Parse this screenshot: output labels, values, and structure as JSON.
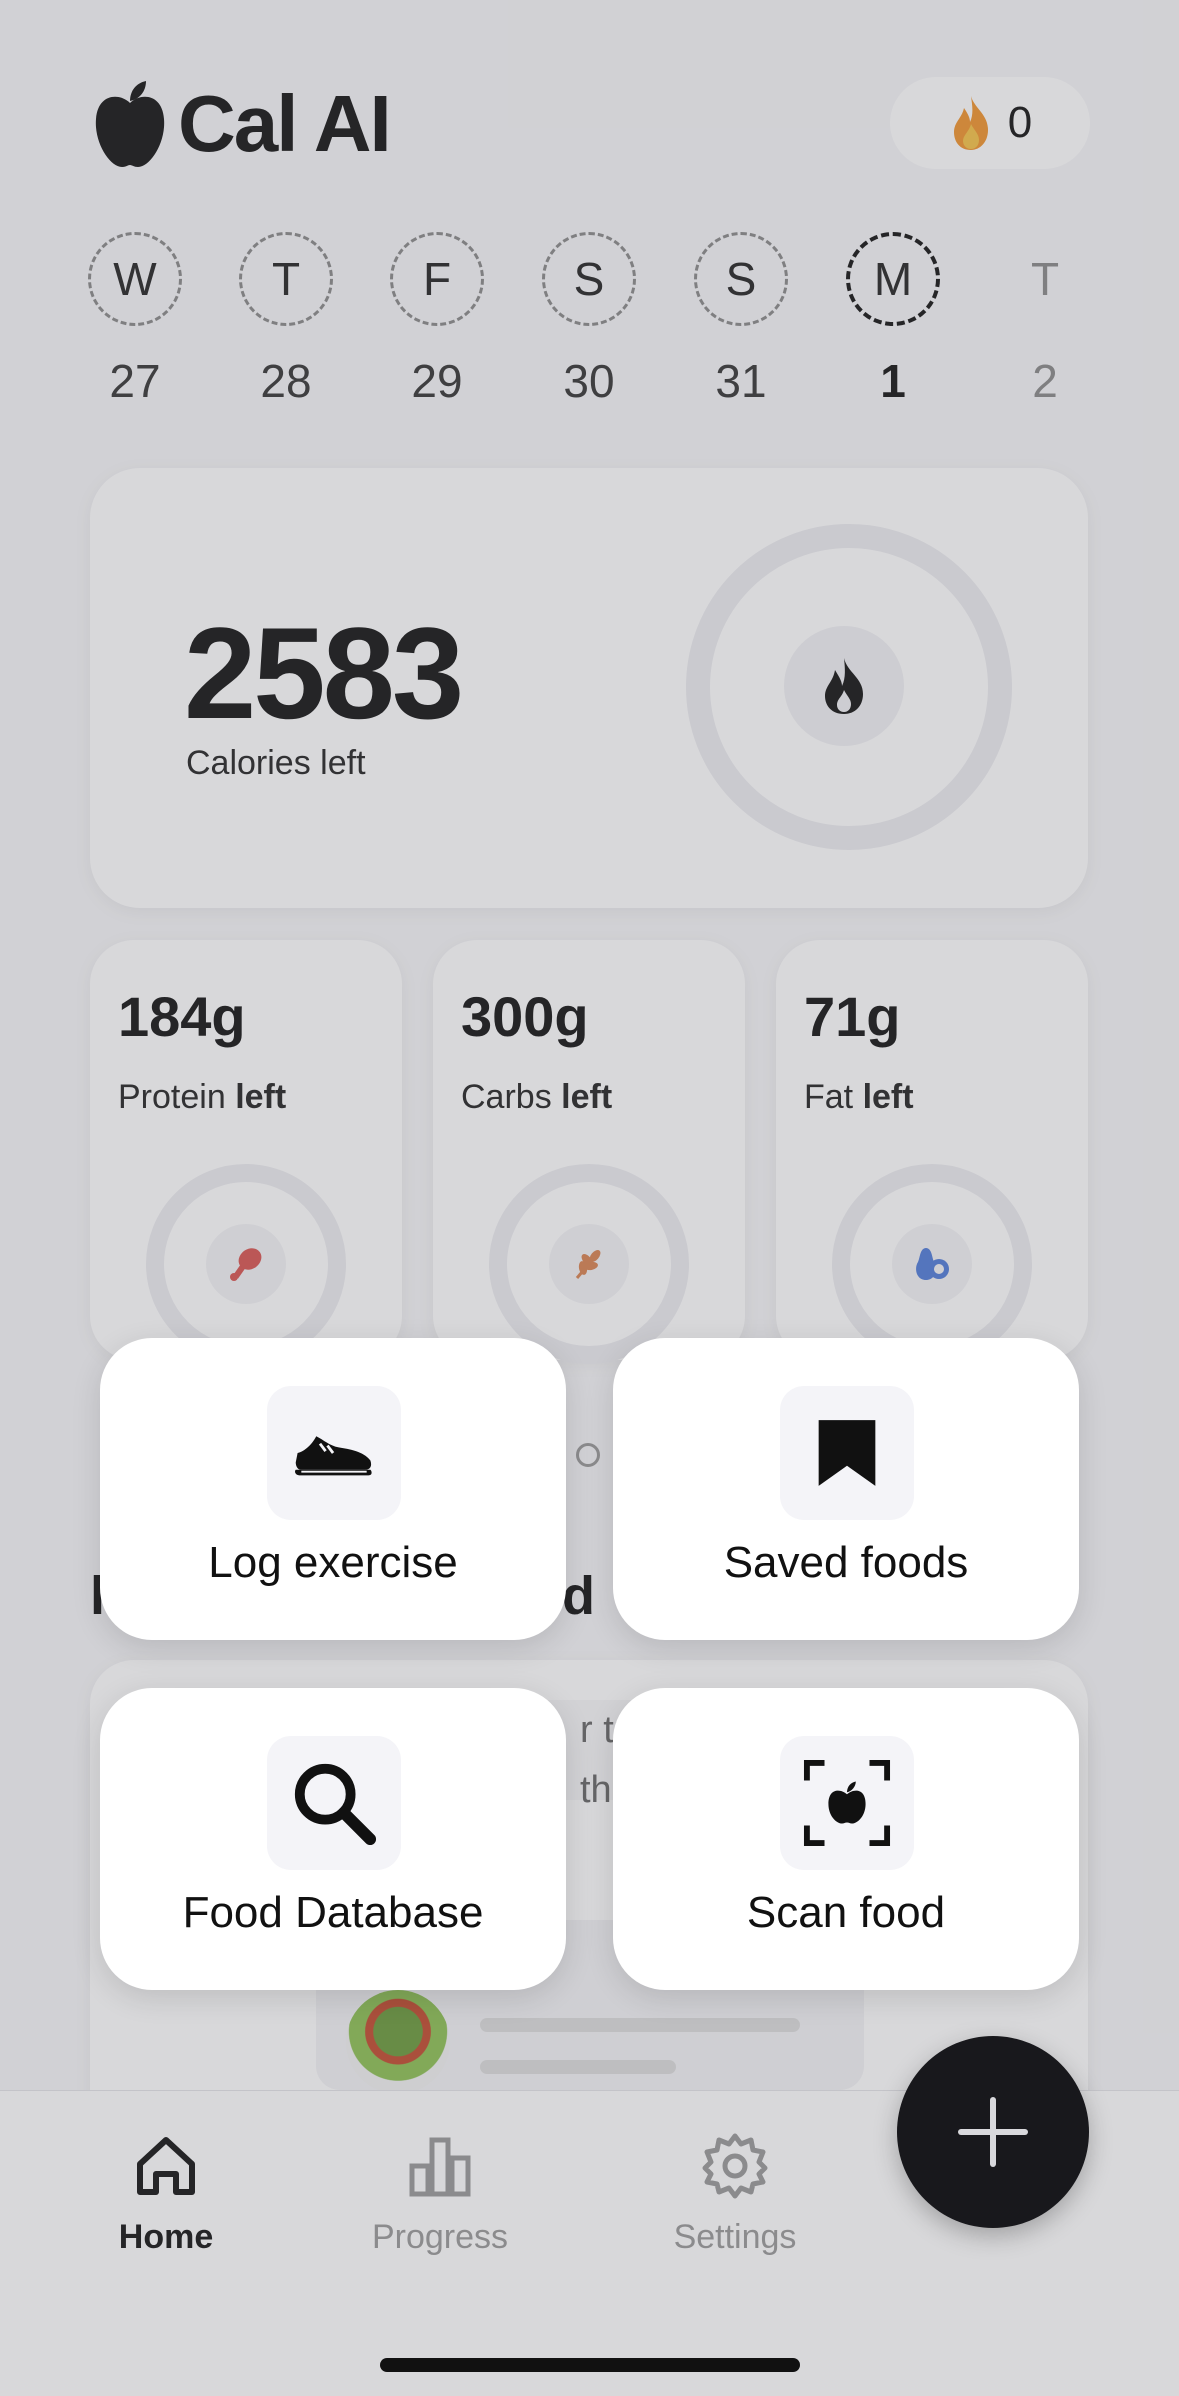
{
  "app": {
    "title": "Cal AI"
  },
  "streak": {
    "count": "0",
    "icon": "fire-icon"
  },
  "week": [
    {
      "letter": "W",
      "date": "27"
    },
    {
      "letter": "T",
      "date": "28"
    },
    {
      "letter": "F",
      "date": "29"
    },
    {
      "letter": "S",
      "date": "30"
    },
    {
      "letter": "S",
      "date": "31"
    },
    {
      "letter": "M",
      "date": "1"
    },
    {
      "letter": "T",
      "date": "2"
    }
  ],
  "calories": {
    "value": "2583",
    "label": "Calories left"
  },
  "macros": [
    {
      "value": "184g",
      "name": "Protein",
      "suffix": "left",
      "icon": "drumstick-icon",
      "color": "#d9534f"
    },
    {
      "value": "300g",
      "name": "Carbs",
      "suffix": "left",
      "icon": "wheat-icon",
      "color": "#d9824f"
    },
    {
      "value": "71g",
      "name": "Fat",
      "suffix": "left",
      "icon": "avocado-icon",
      "color": "#4f7bd9"
    }
  ],
  "actions": [
    {
      "label": "Log exercise",
      "icon": "shoe-icon"
    },
    {
      "label": "Saved foods",
      "icon": "bookmark-icon"
    },
    {
      "label": "Food Database",
      "icon": "search-icon"
    },
    {
      "label": "Scan food",
      "icon": "scan-icon"
    }
  ],
  "background_fragments": {
    "left": "l",
    "right": "d",
    "hint_line1": "r tu",
    "hint_line2": "the"
  },
  "tabs": [
    {
      "label": "Home",
      "icon": "home-icon",
      "active": true
    },
    {
      "label": "Progress",
      "icon": "bar-chart-icon",
      "active": false
    },
    {
      "label": "Settings",
      "icon": "gear-icon",
      "active": false
    }
  ],
  "fab": {
    "icon": "plus-icon"
  }
}
